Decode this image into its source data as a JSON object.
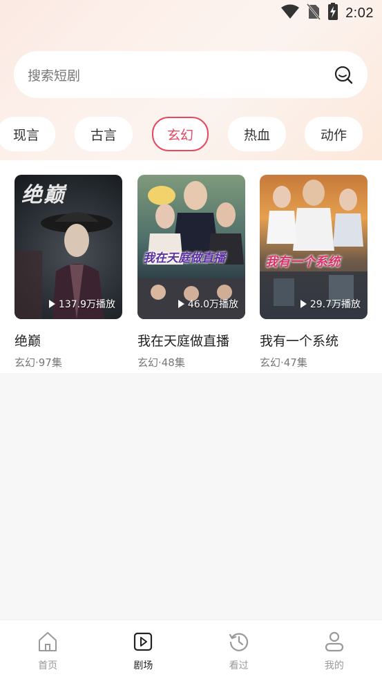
{
  "status_bar": {
    "time": "2:02",
    "icons": [
      "wifi-icon",
      "no-sim-icon",
      "battery-charging-icon"
    ]
  },
  "search": {
    "placeholder": "搜索短剧",
    "icon": "search-icon"
  },
  "categories": [
    {
      "label": "现言",
      "active": false
    },
    {
      "label": "古言",
      "active": false
    },
    {
      "label": "玄幻",
      "active": true
    },
    {
      "label": "热血",
      "active": false
    },
    {
      "label": "动作",
      "active": false
    }
  ],
  "dramas": [
    {
      "title": "绝巅",
      "meta": "玄幻·97集",
      "plays": "137.9万播放",
      "poster_text": "绝巅"
    },
    {
      "title": "我在天庭做直播",
      "meta": "玄幻·48集",
      "plays": "46.0万播放",
      "poster_text": "我在天庭做直播"
    },
    {
      "title": "我有一个系统",
      "meta": "玄幻·47集",
      "plays": "29.7万播放",
      "poster_text": "我有一个系统"
    }
  ],
  "bottom_nav": [
    {
      "label": "首页",
      "icon": "home-icon",
      "active": false
    },
    {
      "label": "剧场",
      "icon": "theater-play-icon",
      "active": true
    },
    {
      "label": "看过",
      "icon": "history-icon",
      "active": false
    },
    {
      "label": "我的",
      "icon": "profile-icon",
      "active": false
    }
  ],
  "colors": {
    "accent": "#e7475f",
    "inactive_nav": "#999999"
  }
}
